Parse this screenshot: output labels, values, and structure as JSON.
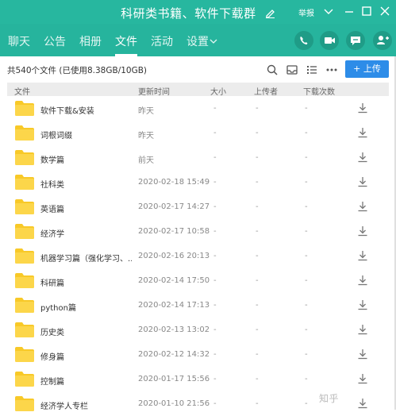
{
  "window": {
    "title": "科研类书籍、软件下载群",
    "report": "举报"
  },
  "colors": {
    "header": "#27b79f",
    "accent": "#2d8ce8",
    "folder": "#f8c928"
  },
  "tabs": [
    {
      "label": "聊天"
    },
    {
      "label": "公告"
    },
    {
      "label": "相册"
    },
    {
      "label": "文件"
    },
    {
      "label": "活动"
    },
    {
      "label": "设置"
    }
  ],
  "toolbar": {
    "file_info": "共540个文件 (已使用8.38GB/10GB)",
    "upload_label": "上传",
    "upload_plus": "+"
  },
  "table": {
    "headers": {
      "name": "文件",
      "time": "更新时间",
      "size": "大小",
      "uploader": "上传者",
      "downloads": "下载次数"
    },
    "rows": [
      {
        "name": "软件下载&安装",
        "time": "昨天",
        "size": "-",
        "uploader": "-",
        "downloads": "-"
      },
      {
        "name": "词根词缀",
        "time": "昨天",
        "size": "-",
        "uploader": "-",
        "downloads": "-"
      },
      {
        "name": "数学篇",
        "time": "前天",
        "size": "-",
        "uploader": "-",
        "downloads": "-"
      },
      {
        "name": "社科类",
        "time": "2020-02-18 15:49",
        "size": "-",
        "uploader": "-",
        "downloads": "-"
      },
      {
        "name": "英语篇",
        "time": "2020-02-17 14:27",
        "size": "-",
        "uploader": "-",
        "downloads": "-"
      },
      {
        "name": "经济学",
        "time": "2020-02-17 10:58",
        "size": "-",
        "uploader": "-",
        "downloads": "-"
      },
      {
        "name": "机器学习篇（强化学习、...",
        "time": "2020-02-16 20:13",
        "size": "-",
        "uploader": "-",
        "downloads": "-"
      },
      {
        "name": "科研篇",
        "time": "2020-02-14 17:50",
        "size": "-",
        "uploader": "-",
        "downloads": "-"
      },
      {
        "name": "python篇",
        "time": "2020-02-14 17:13",
        "size": "-",
        "uploader": "-",
        "downloads": "-"
      },
      {
        "name": "历史类",
        "time": "2020-02-13 13:02",
        "size": "-",
        "uploader": "-",
        "downloads": "-"
      },
      {
        "name": "修身篇",
        "time": "2020-02-12 14:32",
        "size": "-",
        "uploader": "-",
        "downloads": "-"
      },
      {
        "name": "控制篇",
        "time": "2020-01-17 15:56",
        "size": "-",
        "uploader": "-",
        "downloads": "-"
      },
      {
        "name": "经济学人专栏",
        "time": "2020-01-10 21:56",
        "size": "-",
        "uploader": "-",
        "downloads": "-"
      }
    ]
  },
  "watermark": "知乎"
}
